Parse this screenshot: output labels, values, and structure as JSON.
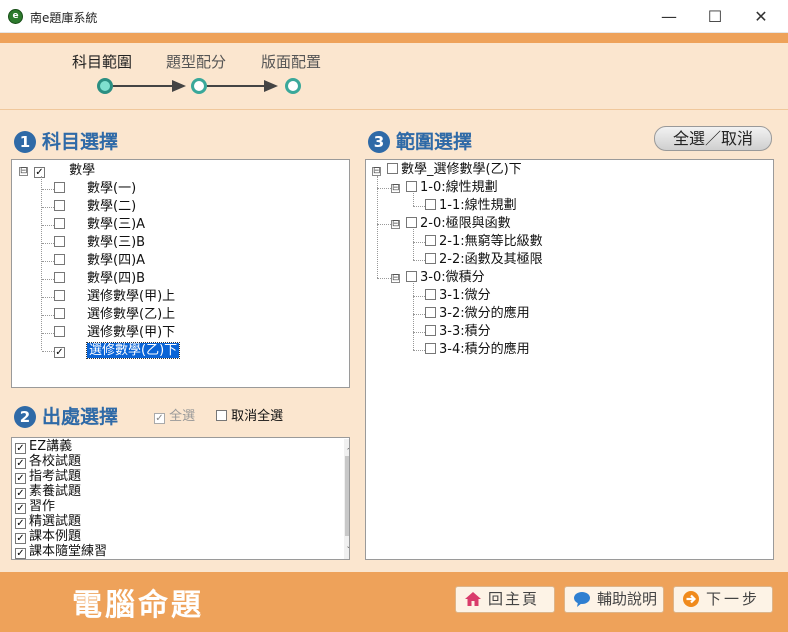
{
  "window": {
    "title": "南e題庫系統",
    "app_icon": "e",
    "minimize": "—",
    "maximize": "☐",
    "close": "✕"
  },
  "wizard": {
    "steps": [
      {
        "label": "科目範圍",
        "active": true
      },
      {
        "label": "題型配分",
        "active": false
      },
      {
        "label": "版面配置",
        "active": false
      }
    ]
  },
  "subject": {
    "number": "1",
    "title": "科目選擇",
    "root": {
      "label": "數學",
      "expander": "⊟",
      "check": "✓"
    },
    "items": [
      {
        "label": "數學(一)",
        "checked": false
      },
      {
        "label": "數學(二)",
        "checked": false
      },
      {
        "label": "數學(三)A",
        "checked": false
      },
      {
        "label": "數學(三)B",
        "checked": false
      },
      {
        "label": "數學(四)A",
        "checked": false
      },
      {
        "label": "數學(四)B",
        "checked": false
      },
      {
        "label": "選修數學(甲)上",
        "checked": false
      },
      {
        "label": "選修數學(乙)上",
        "checked": false
      },
      {
        "label": "選修數學(甲)下",
        "checked": false
      },
      {
        "label": "選修數學(乙)下",
        "checked": true,
        "selected": true
      }
    ]
  },
  "source": {
    "number": "2",
    "title": "出處選擇",
    "select_all": "全選",
    "select_all_checked": true,
    "deselect_all": "取消全選",
    "deselect_all_checked": false,
    "items": [
      {
        "label": "EZ講義",
        "checked": true
      },
      {
        "label": "各校試題",
        "checked": true
      },
      {
        "label": "指考試題",
        "checked": true
      },
      {
        "label": "素養試題",
        "checked": true
      },
      {
        "label": "習作",
        "checked": true
      },
      {
        "label": "精選試題",
        "checked": true
      },
      {
        "label": "課本例題",
        "checked": true
      },
      {
        "label": "課本隨堂練習",
        "checked": true
      }
    ]
  },
  "range": {
    "number": "3",
    "title": "範圍選擇",
    "toggle_button": "全選／取消",
    "root": "數學_選修數學(乙)下",
    "chapters": [
      {
        "label": "1-0:線性規劃",
        "sections": [
          "1-1:線性規劃"
        ]
      },
      {
        "label": "2-0:極限與函數",
        "sections": [
          "2-1:無窮等比級數",
          "2-2:函數及其極限"
        ]
      },
      {
        "label": "3-0:微積分",
        "sections": [
          "3-1:微分",
          "3-2:微分的應用",
          "3-3:積分",
          "3-4:積分的應用"
        ]
      }
    ]
  },
  "footer": {
    "brand": "電腦命題",
    "home": "回主頁",
    "help": "輔助說明",
    "next": "下一步"
  },
  "colors": {
    "accent_orange": "#eea25a",
    "background": "#fbe6cf",
    "section_blue": "#2f6aa7",
    "step_teal": "#3aa89a",
    "selection": "#0a64d6"
  }
}
